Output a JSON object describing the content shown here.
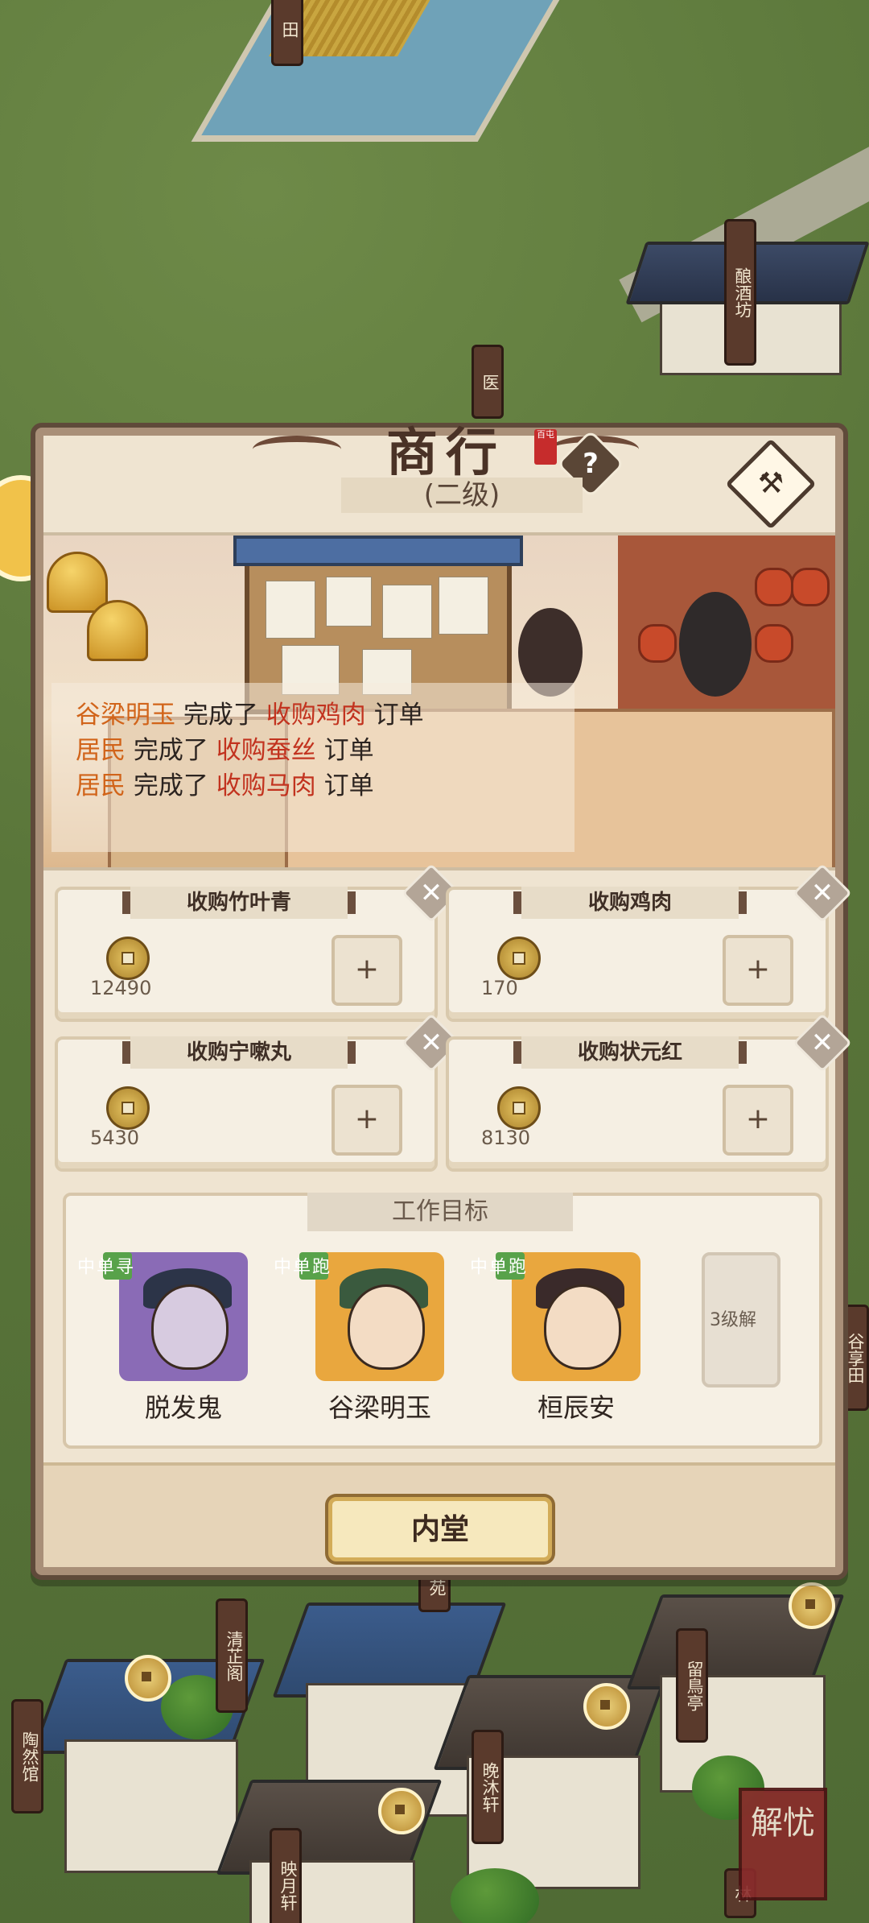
{
  "shop": {
    "title": "商行",
    "seal": "百屯",
    "level": "(二级)",
    "help": "?"
  },
  "map_signs": {
    "top_partial": "田",
    "brewery": "酿酒坊",
    "clinic": "医",
    "qingzhi": "清芷阁",
    "taoran": "陶然馆",
    "wanmu": "晚沐轩",
    "yingyue": "映月轩",
    "liuhu": "留鳥亭",
    "right_partial": "谷享田",
    "lin": "林",
    "zhu": "苑"
  },
  "order_log": [
    {
      "name": "谷梁明玉",
      "verb": "完成了",
      "order": "收购鸡肉",
      "suffix": "订单"
    },
    {
      "name": "居民",
      "verb": "完成了",
      "order": "收购蚕丝",
      "suffix": "订单"
    },
    {
      "name": "居民",
      "verb": "完成了",
      "order": "收购马肉",
      "suffix": "订单"
    }
  ],
  "orders": [
    {
      "title": "收购竹叶青",
      "amount": "12490",
      "plus": "+"
    },
    {
      "title": "收购鸡肉",
      "amount": "170",
      "plus": "+"
    },
    {
      "title": "收购宁嗽丸",
      "amount": "5430",
      "plus": "+"
    },
    {
      "title": "收购状元红",
      "amount": "8130",
      "plus": "+"
    }
  ],
  "goals": {
    "title": "工作目标",
    "workers": [
      {
        "name": "脱发鬼",
        "status": "寻单中",
        "color": "#8a6bb6"
      },
      {
        "name": "谷梁明玉",
        "status": "跑单中",
        "color": "#e9a73e"
      },
      {
        "name": "桓辰安",
        "status": "跑单中",
        "color": "#e9a73e"
      }
    ],
    "locked": "3级解"
  },
  "inner_hall": "内堂",
  "corner": "解忧",
  "colors": {
    "accent_orange": "#d1641a",
    "accent_red": "#c2331f",
    "tag_green": "#58a24a"
  }
}
